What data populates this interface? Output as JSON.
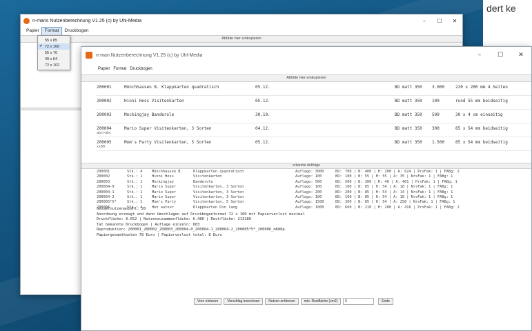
{
  "corner_text": "dert ke",
  "back_window": {
    "title": "n-mans Nutzenberechnung V1.25 (c) by Uhl-Media",
    "controls": [
      "–",
      "☐",
      "✕"
    ],
    "menu": [
      {
        "label": "Papier"
      },
      {
        "label": "Format"
      },
      {
        "label": "Druckbogen"
      }
    ],
    "section_header": "Abfälle hier einkopieren",
    "format_menu": [
      {
        "label": "55 x 85",
        "checked": false
      },
      {
        "label": "72 x 100",
        "checked": true
      },
      {
        "label": "55 x 70",
        "checked": false
      },
      {
        "label": "49 x 64",
        "checked": false
      },
      {
        "label": "72 x 102",
        "checked": false
      }
    ],
    "checkmark": "✔"
  },
  "front_window": {
    "title": "n-man Nutzenberechnung V1.25 (c) by Uhl-Media",
    "controls": [
      "–",
      "☐",
      "✕"
    ],
    "menu": [
      {
        "label": "Papier"
      },
      {
        "label": "Format"
      },
      {
        "label": "Druckbogen"
      }
    ],
    "section_header_top": "Abfälle hier einkopieren",
    "top_rows": [
      {
        "id": "200001",
        "name": "Münchhausen B. Klappkarten quadratisch",
        "date": "05.12.",
        "paper": "BD matt 350",
        "qty": "3.000",
        "size": "220 x 200 mm 4 Seiten",
        "extra": ""
      },
      {
        "id": "200002",
        "name": "Hinni Hess Visitenkarten",
        "date": "05.12.",
        "paper": "BD matt 350",
        "qty": "100",
        "size": "rund 55 mm beidseitig",
        "extra": ""
      },
      {
        "id": "200003",
        "name": "Mockingjay Banderole",
        "date": "30.10.",
        "paper": "BD matt 350",
        "qty": "500",
        "size": "30 x 4 cm einseitig",
        "extra": ""
      },
      {
        "id": "200004",
        "name": "Mario Super Visitenkarten, 3 Sorten",
        "date": "04.12.",
        "paper": "BD matt 350",
        "qty": "300",
        "size": "85 x 54 mm beidseitig",
        "extra": "abc=abc"
      },
      {
        "id": "200005",
        "name": "Mom's Party Visitenkarten, 5 Sorten",
        "date": "05.12.",
        "paper": "BD matt 350",
        "qty": "1.500",
        "size": "85 x 54 mm beidseitig",
        "extra": "xx00"
      }
    ],
    "section_header_detail": "erkannte Aufträge",
    "detail_rows": [
      {
        "id": "200001",
        "stk": "Stk.: 4",
        "name": "Münchhausen B.",
        "desc": "Klappkarten quadratisch",
        "aufl": "Auflage: 3000",
        "bd": "BD:",
        "rest": "700 | B: 400 | H: 200 | A: 624 | PrsFak: 1 | FABg: 2"
      },
      {
        "id": "200002",
        "stk": "Stk.: 1",
        "name": "Hinni Hess",
        "desc": "Visitenkarten",
        "aufl": "Auflage: 100",
        "bd": "BD:",
        "rest": "100 | B: 55 | H: 55 | A: 35 | NrsFak: 1 | FABg: 1"
      },
      {
        "id": "200003",
        "stk": "Stk.: 1",
        "name": "Mockingjay",
        "desc": "Banderole",
        "aufl": "Auflage: 500",
        "bd": "BD:",
        "rest": "500 | B: 300 | H: 40 | A: 461 | PrsFak: 1 | FABg: 1"
      },
      {
        "id": "200004-0",
        "stk": "Stk.: 1",
        "name": "Mario Super",
        "desc": "Visitenkarten, 3 Sorten",
        "aufl": "Auflage: 100",
        "bd": "BD:",
        "rest": "100 | B: 85 | H: 54 | A: 18 | NrsFak: 1 | FABg: 1"
      },
      {
        "id": "200004-1",
        "stk": "Stk.: 1",
        "name": "Mario Super",
        "desc": "Visitenkarten, 3 Sorten",
        "aufl": "Auflage: 200",
        "bd": "BD:",
        "rest": "200 | B: 85 | H: 54 | A: 14 | NrsFak: 1 | FABg: 1"
      },
      {
        "id": "200004-2",
        "stk": "Stk.: 1",
        "name": "Mario Super",
        "desc": "Visitenkarten, 3 Sorten",
        "aufl": "Auflage: 100",
        "bd": "BD:",
        "rest": "100 | B: 85 | H: 54 | A: 18 | NrsFak: 1 | FABg: 1"
      },
      {
        "id": "200005*5*",
        "stk": "Stk.: 1",
        "name": "Mom's Party",
        "desc": "Visitenkarten, 5 Sorten",
        "aufl": "Auflage: 1500",
        "bd": "BD:",
        "rest": "300 | B: 85 | H: 54 | A: 250 | NrsFak: 1 | FABg: 1"
      },
      {
        "id": "200006",
        "stk": "Stk.: 4",
        "name": "Hen autour",
        "desc": "Klappkarten Din lang",
        "aufl": "Auflage: 1000",
        "bd": "BD:",
        "rest": "660 | B: 210 | H: 200 | A: 416 | PrsFak: 1 | FABg: 2"
      }
    ],
    "summary_lines": [
      "Gesamtnutzenanzahl: 20",
      "Anordnung erzeugt und dann Umschlagen auf Druckbogenformat 72 x 100 mit Papierverlust maximal",
      "Druckfläche: 6.652 | Nutzenzusammenfläche: 6.480 | Restfläche: 213180",
      "Tat bekannte Druckbogen | Auflage einzeln: 683",
      "Reproduktion: 200001_200002_200003_200004-0_200004-1_200004-2_200005*5*_200006_m680p",
      "Papiergesamtkosten 78 Euro | Papierverlust total: 8 Euro"
    ],
    "bottom_bar": {
      "buttons": [
        {
          "label": "Vorn einlesen"
        },
        {
          "label": "Vorschlag berechnen"
        },
        {
          "label": "Nutzen entfernen"
        }
      ],
      "field_label": "min. Restfläche (cm2)",
      "field_value": "0",
      "end_button": "Ende"
    }
  }
}
